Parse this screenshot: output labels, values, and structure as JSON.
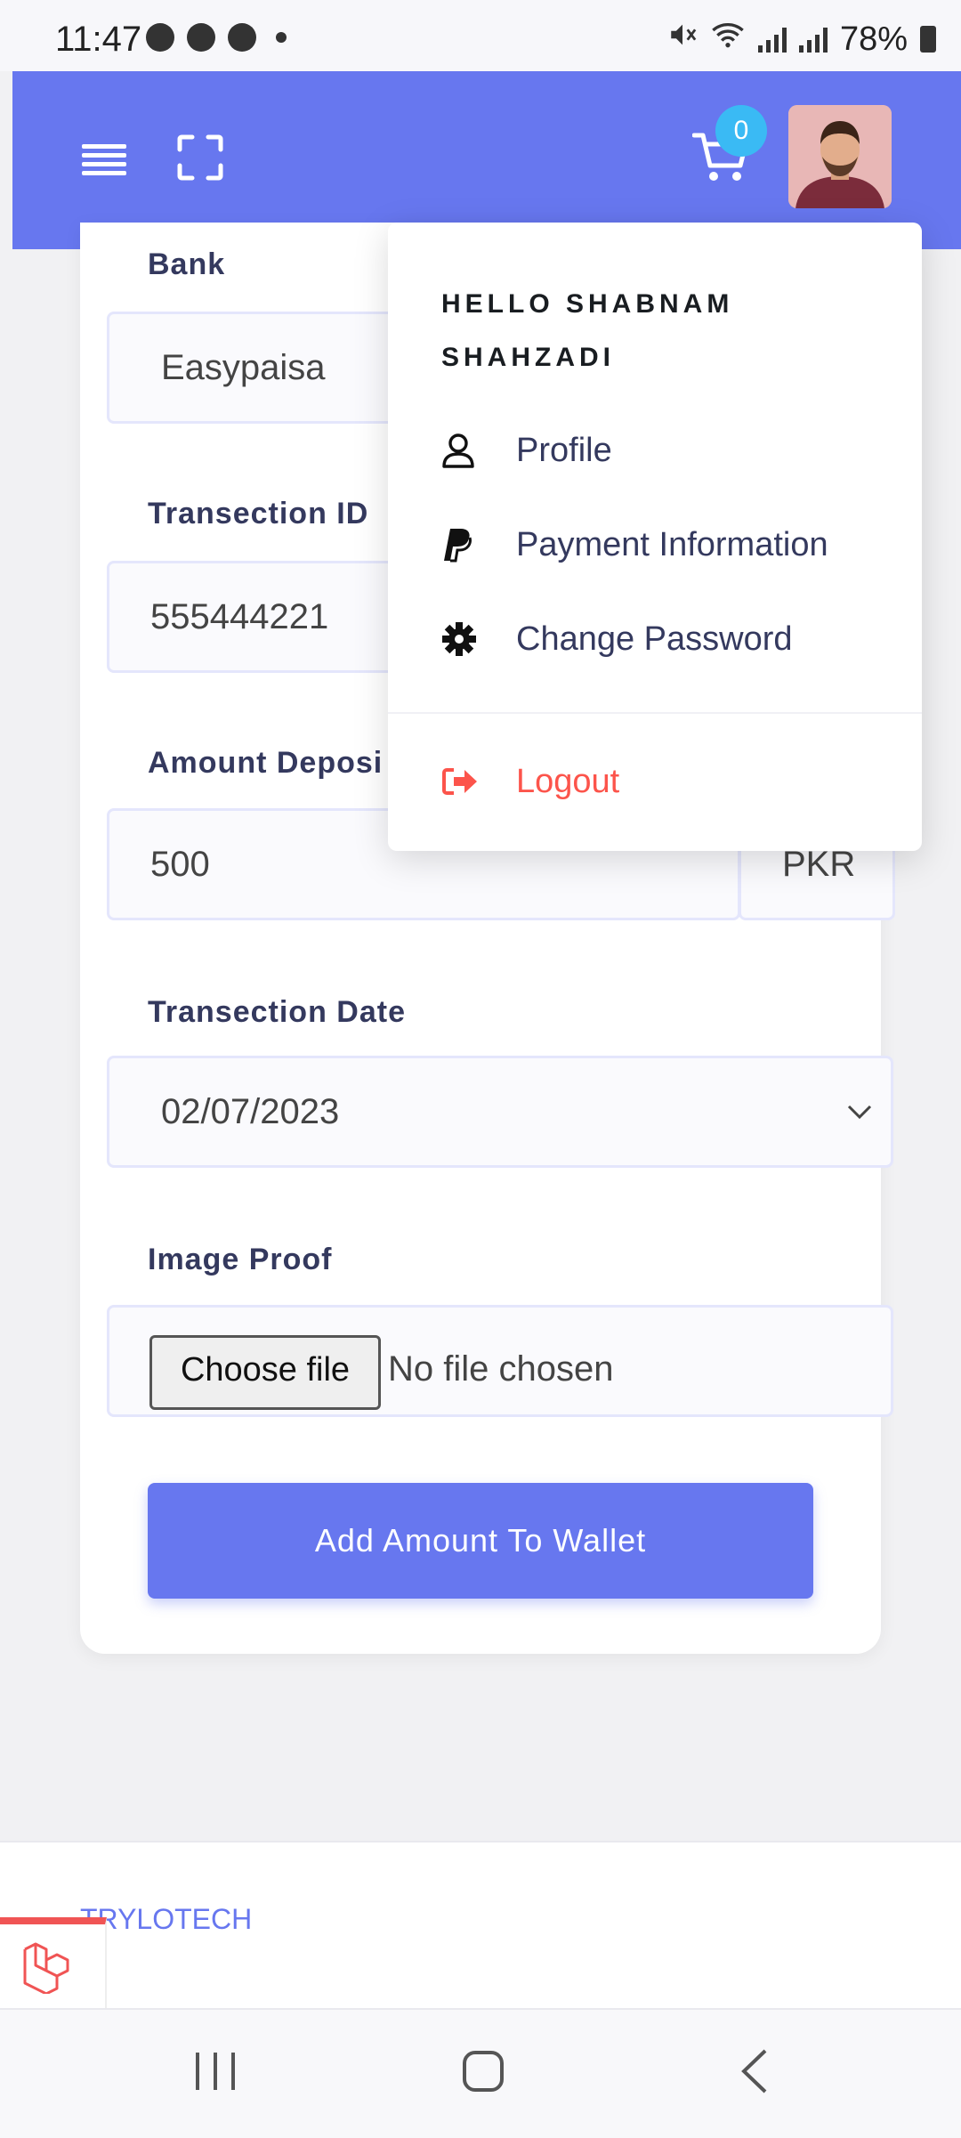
{
  "status_bar": {
    "time": "11:47",
    "battery": "78%"
  },
  "header": {
    "cart_count": "0"
  },
  "form": {
    "bank": {
      "label": "Bank",
      "value": "Easypaisa"
    },
    "transaction_id": {
      "label": "Transection ID",
      "value": "555444221"
    },
    "amount": {
      "label": "Amount Deposi",
      "value": "500",
      "currency": "PKR"
    },
    "transaction_date": {
      "label": "Transection Date",
      "value": "02/07/2023"
    },
    "image_proof": {
      "label": "Image Proof",
      "button": "Choose file",
      "status": "No file chosen"
    },
    "submit": "Add Amount To Wallet"
  },
  "dropdown": {
    "greeting": "HELLO SHABNAM SHAHZADI",
    "items": [
      {
        "label": "Profile",
        "icon": "user-icon"
      },
      {
        "label": "Payment Information",
        "icon": "paypal-icon"
      },
      {
        "label": "Change Password",
        "icon": "gear-icon"
      }
    ],
    "logout": "Logout"
  },
  "footer": {
    "brand": "TRYLOTECH"
  },
  "colors": {
    "primary": "#6777ef",
    "badge": "#3abaf4",
    "danger": "#fc544b"
  }
}
